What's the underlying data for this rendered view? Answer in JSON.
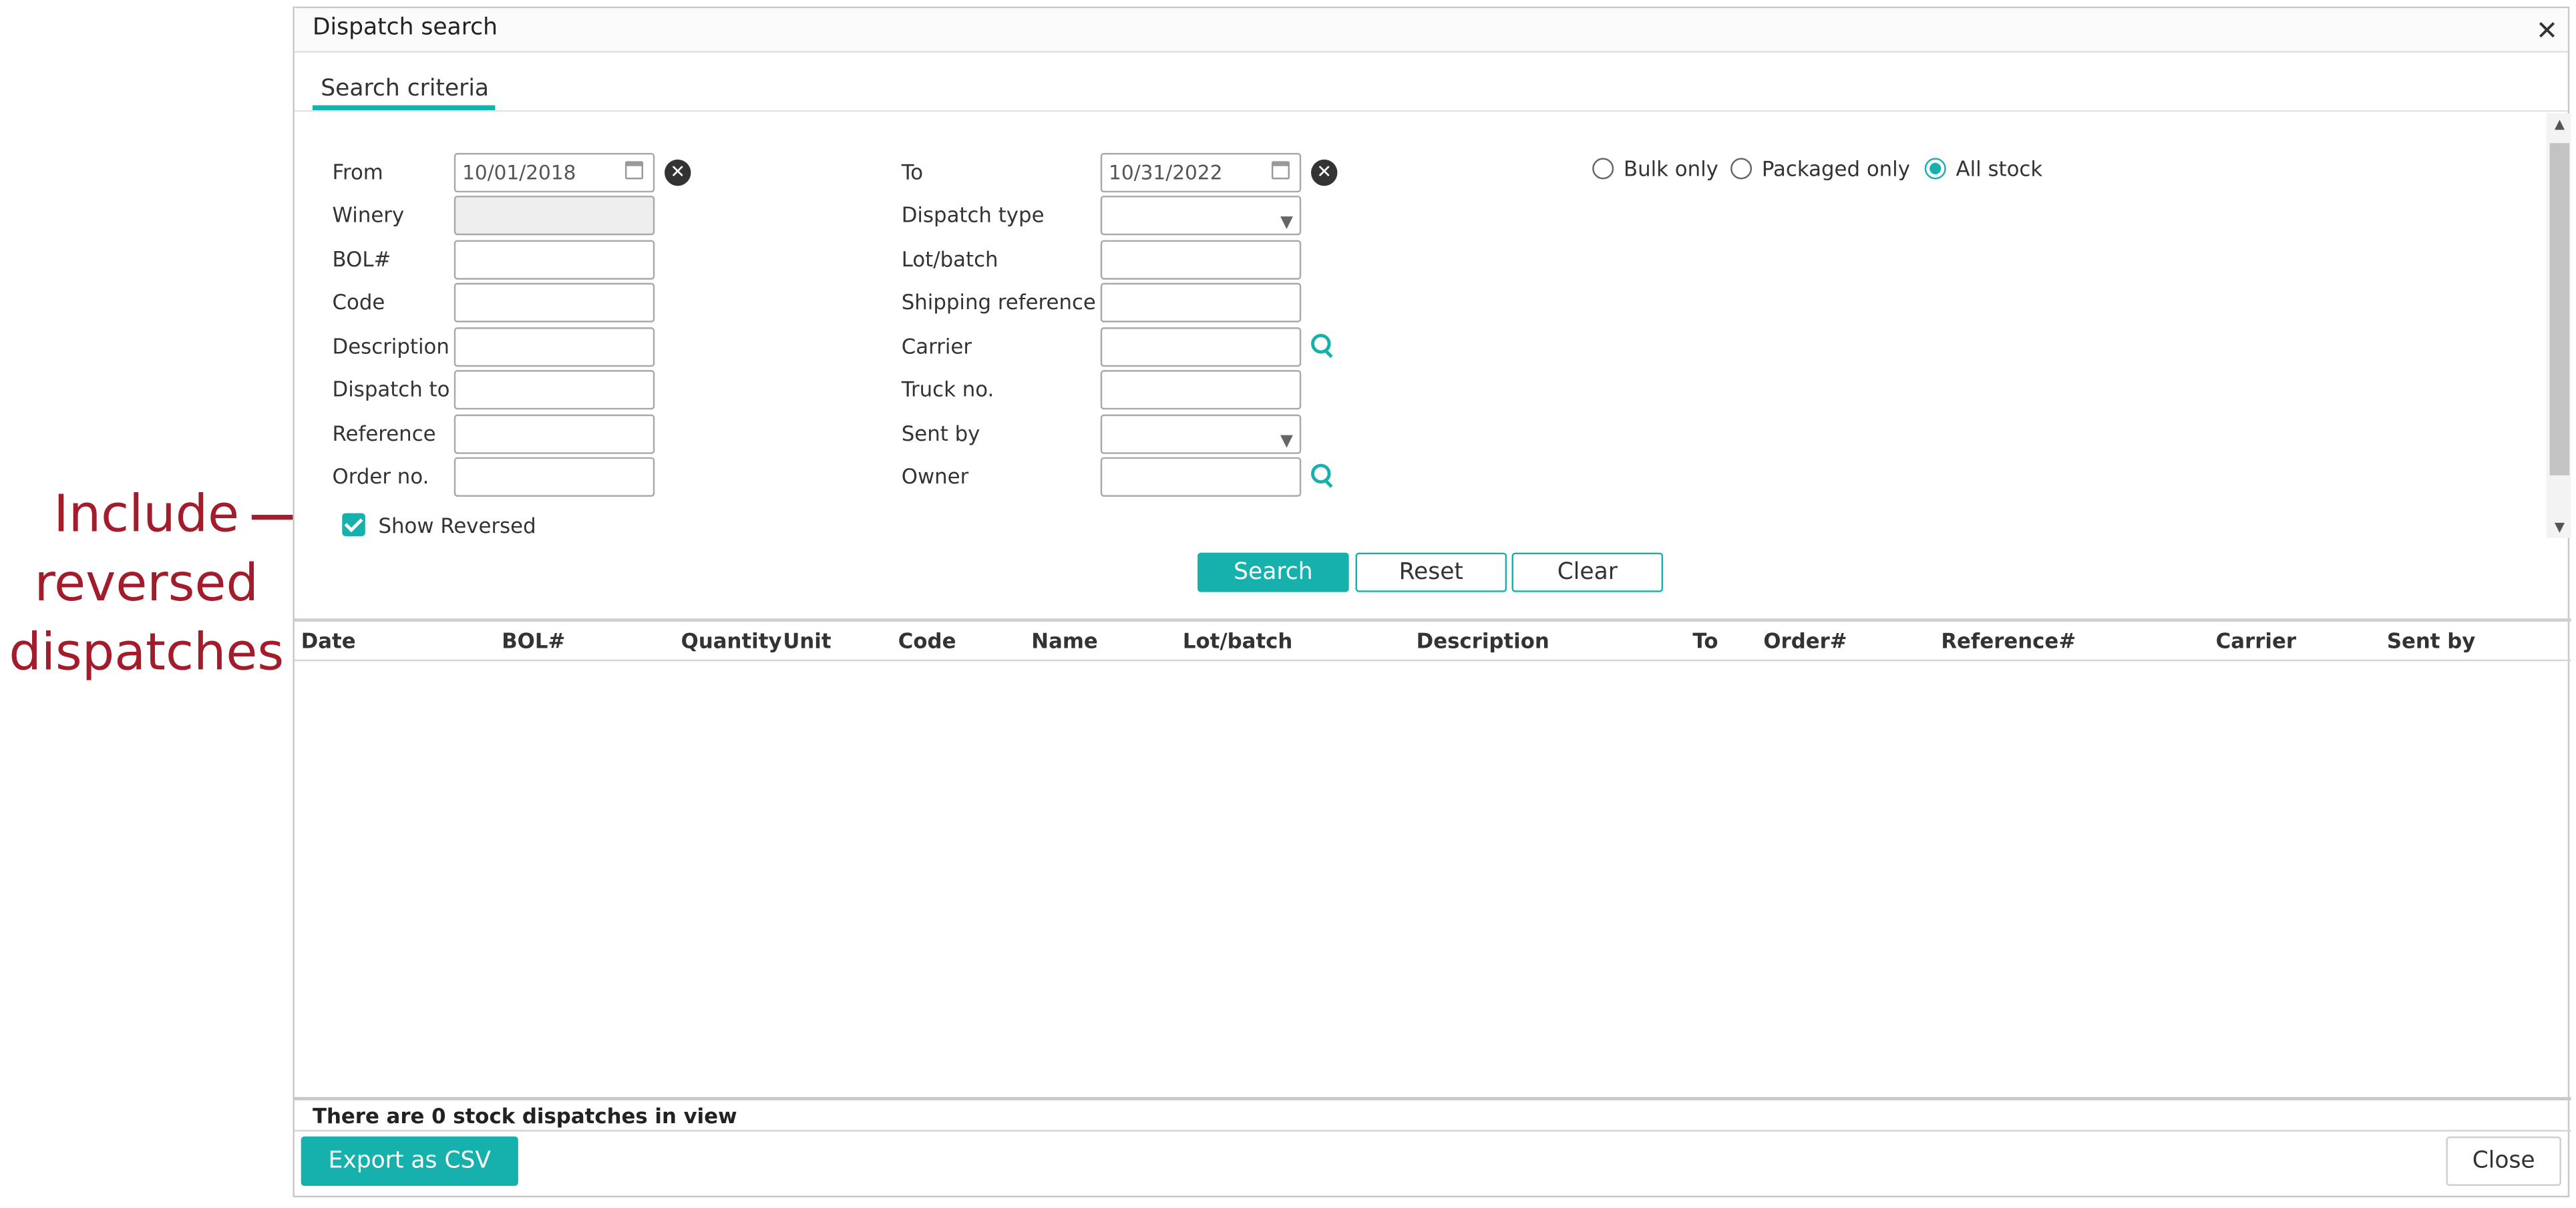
{
  "annotation": {
    "lines": [
      "Include",
      "reversed",
      "dispatches"
    ],
    "color": "#a31c2c"
  },
  "dialog": {
    "title": "Dispatch search",
    "close_glyph": "✕"
  },
  "tabs": [
    {
      "label": "Search criteria",
      "active": true
    }
  ],
  "form": {
    "from_label": "From",
    "from_value": "10/01/2018",
    "to_label": "To",
    "to_value": "10/31/2022",
    "winery_label": "Winery",
    "dispatch_type_label": "Dispatch type",
    "bol_label": "BOL#",
    "lot_batch_label": "Lot/batch",
    "code_label": "Code",
    "shipping_reference_label": "Shipping reference",
    "description_label": "Description",
    "carrier_label": "Carrier",
    "dispatch_to_label": "Dispatch to",
    "truck_no_label": "Truck no.",
    "reference_label": "Reference",
    "sent_by_label": "Sent by",
    "order_no_label": "Order no.",
    "owner_label": "Owner",
    "show_reversed_label": "Show Reversed",
    "show_reversed_checked": true
  },
  "stock_filter": {
    "options": [
      "Bulk only",
      "Packaged only",
      "All stock"
    ],
    "selected": "All stock"
  },
  "actions": {
    "search": "Search",
    "reset": "Reset",
    "clear": "Clear"
  },
  "table": {
    "columns": [
      "Date",
      "BOL#",
      "Quantity",
      "Unit",
      "Code",
      "Name",
      "Lot/batch",
      "Description",
      "To",
      "Order#",
      "Reference#",
      "Carrier",
      "Sent by"
    ],
    "rows": []
  },
  "status_text": "There are 0 stock dispatches in view",
  "footer": {
    "export_label": "Export as CSV",
    "close_label": "Close"
  },
  "colors": {
    "accent": "#17b1ad",
    "annotation": "#a31c2c"
  }
}
